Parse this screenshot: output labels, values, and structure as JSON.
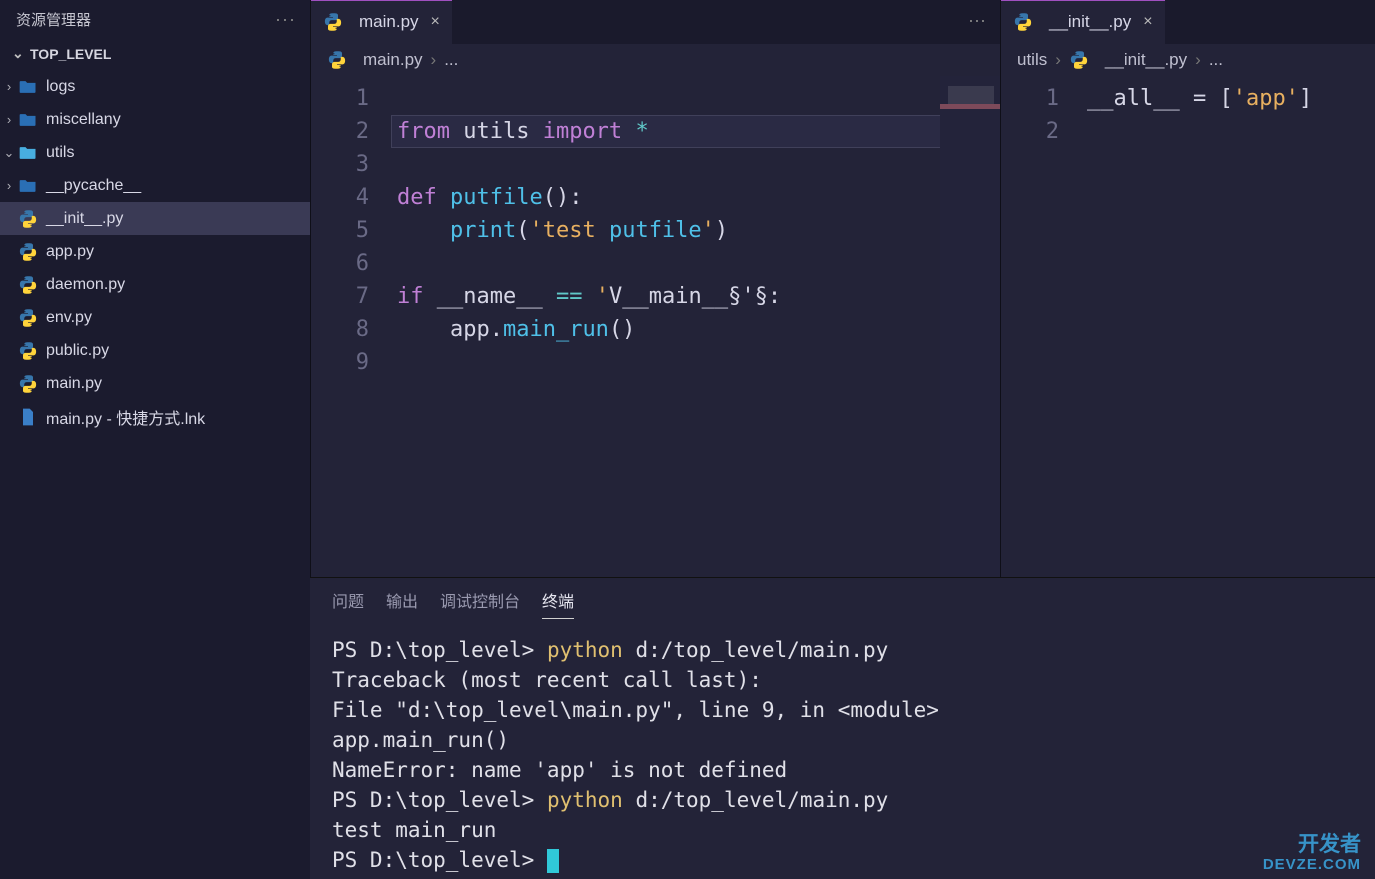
{
  "sidebar": {
    "title": "资源管理器",
    "root": "TOP_LEVEL",
    "items": [
      {
        "label": "logs",
        "kind": "folder",
        "depth": 1,
        "expanded": false
      },
      {
        "label": "miscellany",
        "kind": "folder",
        "depth": 1,
        "expanded": false
      },
      {
        "label": "utils",
        "kind": "folder-o",
        "depth": 1,
        "expanded": true
      },
      {
        "label": "__pycache__",
        "kind": "folder",
        "depth": 2,
        "expanded": false
      },
      {
        "label": "__init__.py",
        "kind": "py",
        "depth": 3,
        "selected": true
      },
      {
        "label": "app.py",
        "kind": "py",
        "depth": 3
      },
      {
        "label": "daemon.py",
        "kind": "py",
        "depth": 3
      },
      {
        "label": "env.py",
        "kind": "py",
        "depth": 3
      },
      {
        "label": "public.py",
        "kind": "py",
        "depth": 3
      },
      {
        "label": "main.py",
        "kind": "py",
        "depth": 1
      },
      {
        "label": "main.py - 快捷方式.lnk",
        "kind": "file",
        "depth": 1
      }
    ]
  },
  "groups": [
    {
      "tab": {
        "label": "main.py",
        "active": true,
        "dirty": false
      },
      "crumbs": [
        "main.py",
        "..."
      ],
      "lines": [
        "",
        "from utils import *",
        "",
        "def putfile():",
        "    print('test putfile')",
        "",
        "if __name__ == '__main__':",
        "    app.main_run()",
        ""
      ],
      "highlight_line": 2
    },
    {
      "tab": {
        "label": "__init__.py",
        "active": true,
        "dirty": false
      },
      "crumbs": [
        "utils",
        "__init__.py",
        "..."
      ],
      "lines": [
        "__all__ = ['app']",
        ""
      ]
    }
  ],
  "panel": {
    "tabs": [
      "问题",
      "输出",
      "调试控制台",
      "终端"
    ],
    "active": 3,
    "terminal": [
      {
        "segs": [
          {
            "t": "PS D:\\top_level> ",
            "c": "wh"
          },
          {
            "t": "python ",
            "c": "yel"
          },
          {
            "t": "d:/top_level/main.py",
            "c": "wh"
          }
        ]
      },
      {
        "segs": [
          {
            "t": "Traceback (most recent call last):",
            "c": "wh"
          }
        ]
      },
      {
        "segs": [
          {
            "t": "  File \"d:\\top_level\\main.py\", line 9, in <module>",
            "c": "wh"
          }
        ]
      },
      {
        "segs": [
          {
            "t": "    app.main_run()",
            "c": "wh"
          }
        ]
      },
      {
        "segs": [
          {
            "t": "NameError: name 'app' is not defined",
            "c": "wh"
          }
        ]
      },
      {
        "segs": [
          {
            "t": "PS D:\\top_level> ",
            "c": "wh"
          },
          {
            "t": "python ",
            "c": "yel"
          },
          {
            "t": "d:/top_level/main.py",
            "c": "wh"
          }
        ]
      },
      {
        "segs": [
          {
            "t": "test main_run",
            "c": "wh"
          }
        ]
      },
      {
        "segs": [
          {
            "t": "PS D:\\top_level> ",
            "c": "wh"
          }
        ]
      }
    ]
  },
  "watermark": {
    "main": "开发者",
    "sub": "DEVZE.COM"
  }
}
